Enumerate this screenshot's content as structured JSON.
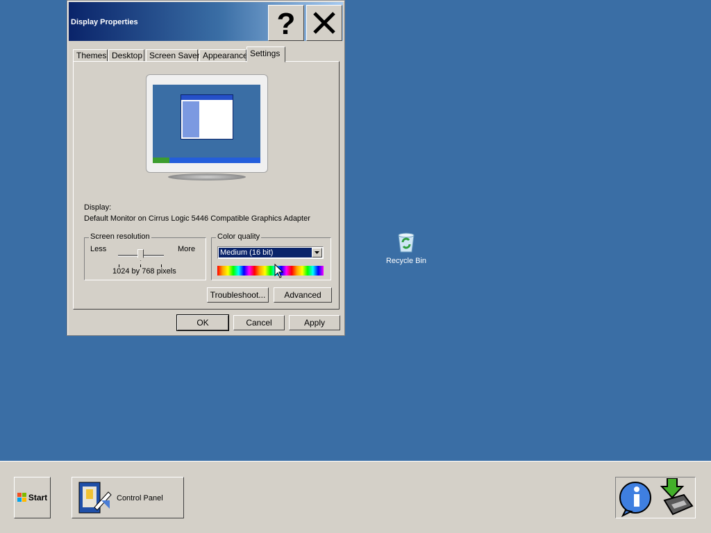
{
  "dialog": {
    "title": "Display Properties",
    "tabs": [
      {
        "label": "Themes"
      },
      {
        "label": "Desktop"
      },
      {
        "label": "Screen Saver"
      },
      {
        "label": "Appearance"
      },
      {
        "label": "Settings"
      }
    ],
    "active_tab": "Settings",
    "display_label": "Display:",
    "display_value": "Default Monitor on Cirrus Logic 5446 Compatible Graphics Adapter",
    "resolution": {
      "legend": "Screen resolution",
      "less": "Less",
      "more": "More",
      "value": "1024 by 768 pixels"
    },
    "color": {
      "legend": "Color quality",
      "selected": "Medium (16 bit)"
    },
    "buttons": {
      "troubleshoot": "Troubleshoot...",
      "advanced": "Advanced",
      "ok": "OK",
      "cancel": "Cancel",
      "apply": "Apply"
    }
  },
  "desktop": {
    "recycle_bin": "Recycle Bin"
  },
  "taskbar": {
    "start": "Start",
    "task": "Control Panel"
  },
  "colors": {
    "desktop": "#3a6ea5",
    "face": "#d4d0c8",
    "title_dark": "#0a246a"
  }
}
